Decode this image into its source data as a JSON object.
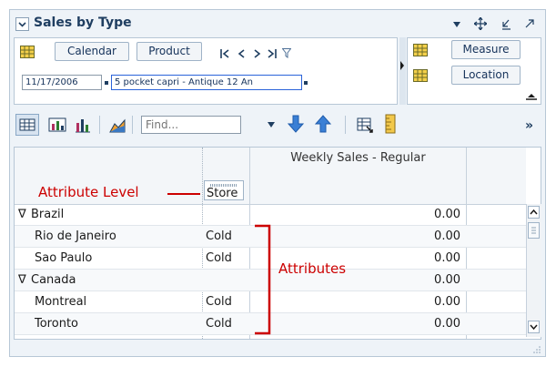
{
  "panel": {
    "title": "Sales by Type",
    "header_icons": [
      "chevron-down-icon",
      "move-icon",
      "minimize-icon",
      "maximize-icon"
    ]
  },
  "dimensions": {
    "rows": {
      "items": [
        "Calendar",
        "Product"
      ],
      "values": [
        "11/17/2006",
        "5 pocket capri - Antique 12 An"
      ]
    },
    "columns": {
      "items": [
        "Measure",
        "Location"
      ]
    },
    "nav_icons": [
      "first-icon",
      "previous-icon",
      "next-icon",
      "last-icon",
      "filter-icon"
    ]
  },
  "toolbar": {
    "find_placeholder": "Find...",
    "icons": [
      "grid-view-icon",
      "chart-grid-icon",
      "bar-chart-icon",
      "area-chart-icon",
      "arrow-down-icon",
      "arrow-up-icon",
      "export-icon",
      "ruler-icon",
      "overflow-icon"
    ]
  },
  "grid": {
    "measure_header": "Weekly Sales - Regular",
    "attribute_header": "Store",
    "annotations": {
      "attribute_level": "Attribute Level",
      "attributes": "Attributes"
    },
    "expand_symbol": "∇",
    "rows": [
      {
        "name": "Brazil",
        "attr": "",
        "value": "0.00",
        "level": 0
      },
      {
        "name": "Rio de Janeiro",
        "attr": "Cold",
        "value": "0.00",
        "level": 1
      },
      {
        "name": "Sao Paulo",
        "attr": "Cold",
        "value": "0.00",
        "level": 1
      },
      {
        "name": "Canada",
        "attr": "",
        "value": "0.00",
        "level": 0
      },
      {
        "name": "Montreal",
        "attr": "Cold",
        "value": "0.00",
        "level": 1
      },
      {
        "name": "Toronto",
        "attr": "Cold",
        "value": "0.00",
        "level": 1
      }
    ]
  },
  "colors": {
    "accent": "#1f3e61",
    "annotation": "#cc0000",
    "panel_bg": "#eef3f8"
  }
}
